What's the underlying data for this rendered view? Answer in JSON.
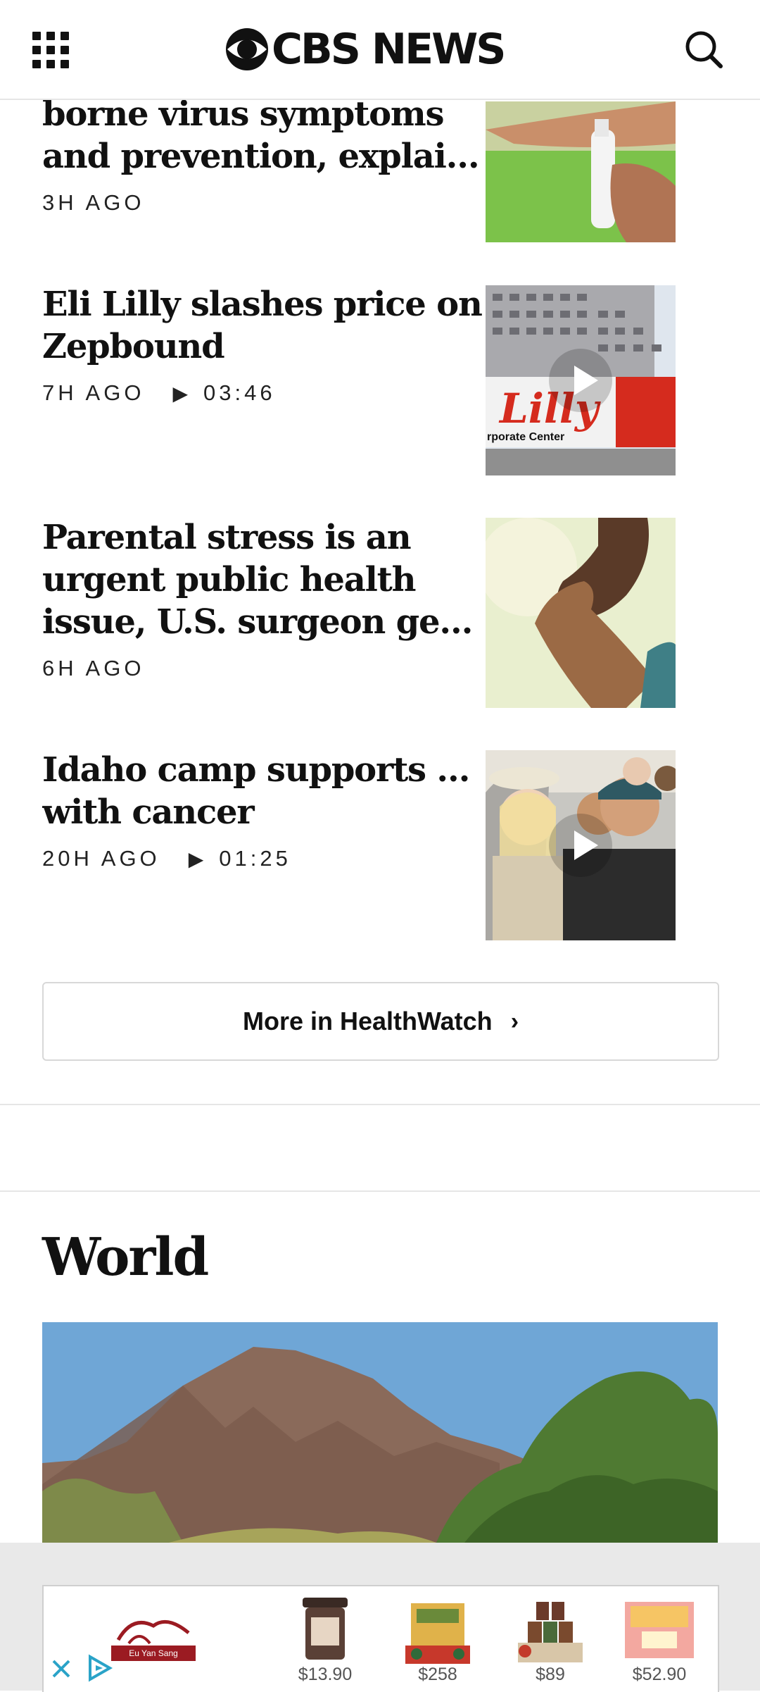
{
  "header": {
    "brand": "CBS NEWS",
    "menu_icon": "grid-menu-icon",
    "search_icon": "search-icon"
  },
  "articles": [
    {
      "title_lines": [
        "borne virus symptoms",
        "and prevention, explained"
      ],
      "time": "3H AGO",
      "duration": "",
      "has_video": false,
      "thumb": "insect-repellent-spray"
    },
    {
      "title_lines": [
        "Eli Lilly slashes price on",
        "Zepbound"
      ],
      "time": "7H AGO",
      "duration": "03:46",
      "has_video": true,
      "thumb": "lilly-corporate-center",
      "thumb_sign": "rporate Center",
      "thumb_logo": "Lilly"
    },
    {
      "title_lines": [
        "Parental stress is an",
        "urgent public health",
        "issue, U.S. surgeon gener…"
      ],
      "time": "6H AGO",
      "duration": "",
      "has_video": false,
      "thumb": "parent-child-hands"
    },
    {
      "title_lines": [
        "Idaho camp supports kids",
        "with cancer"
      ],
      "time": "20H AGO",
      "duration": "01:25",
      "has_video": true,
      "thumb": "camp-kids-portrait"
    }
  ],
  "more_button": {
    "label": "More in HealthWatch",
    "chevron": "›"
  },
  "world_section": {
    "title": "World",
    "hero": "mountain-landscape"
  },
  "ad": {
    "logo_text": "Eu Yan Sang",
    "prices": [
      "$13.90",
      "$258",
      "$89",
      "$52.90"
    ],
    "close_icon": "close-icon",
    "adchoices_icon": "adchoices-icon"
  },
  "colors": {
    "text": "#111111",
    "divider": "#e6e6e6",
    "lilly_red": "#d52b1e",
    "ad_brand": "#9b1b22"
  },
  "glyphs": {
    "play": "▶"
  }
}
